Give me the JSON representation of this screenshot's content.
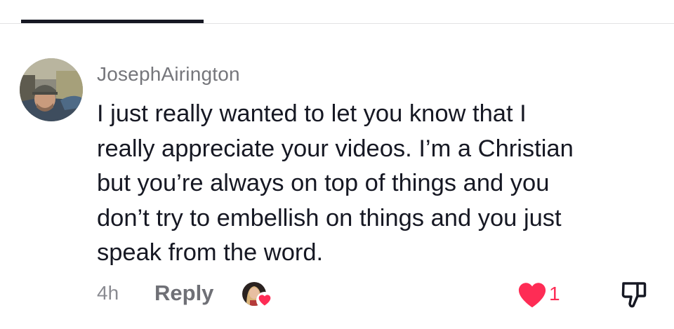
{
  "comment": {
    "username": "JosephAirington",
    "text": "I just really wanted to let you know that I\nreally appreciate your videos. I’m a Christian\nbut you’re always on top of things and you\ndon’t try to embellish on things and you just\nspeak from the word.",
    "timestamp": "4h",
    "reply_label": "Reply",
    "like_count": "1",
    "liked": true,
    "liked_by_creator": true
  },
  "icons": {
    "avatar": "user-avatar-photo",
    "creator_avatar": "creator-avatar-photo",
    "creator_heart": "heart-icon",
    "like": "heart-filled-icon",
    "dislike": "thumbs-down-icon"
  },
  "colors": {
    "accent": "#fe2c55",
    "text_primary": "#161823",
    "text_secondary": "#75767b"
  }
}
